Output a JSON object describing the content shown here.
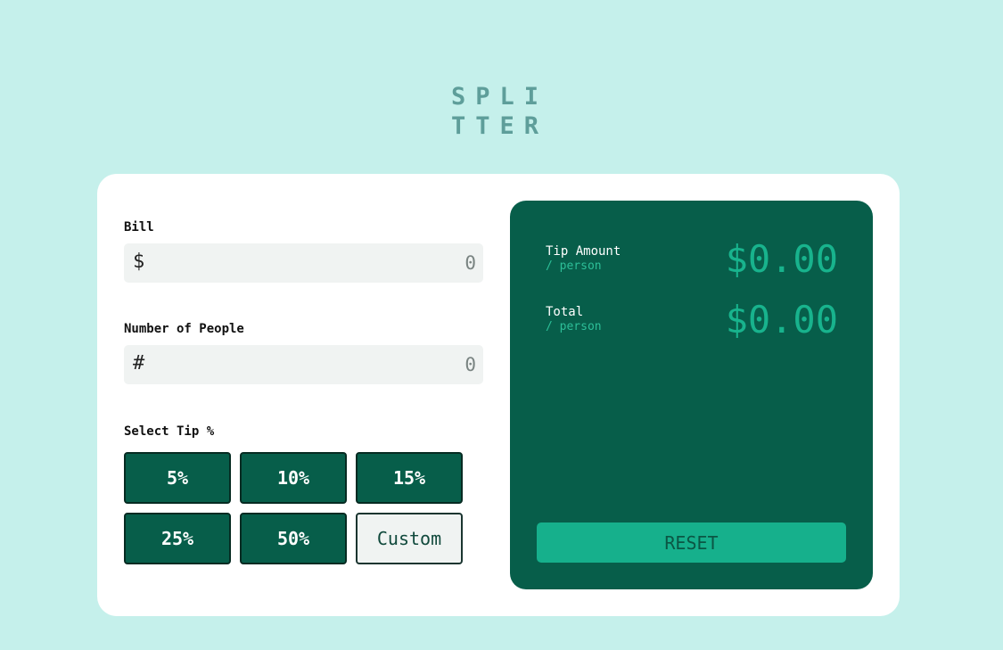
{
  "app": {
    "logo_line1": "SPLI",
    "logo_line2": "TTER"
  },
  "bill": {
    "label": "Bill",
    "prefix": "$",
    "placeholder": "0"
  },
  "people": {
    "label": "Number of People",
    "prefix": "#",
    "placeholder": "0"
  },
  "tip": {
    "label": "Select Tip %",
    "options": [
      "5%",
      "10%",
      "15%",
      "25%",
      "50%"
    ],
    "custom_label": "Custom"
  },
  "results": {
    "tip_title": "Tip Amount",
    "tip_sub": "/ person",
    "tip_value": "$0.00",
    "total_title": "Total",
    "total_sub": "/ person",
    "total_value": "$0.00",
    "reset_label": "RESET"
  },
  "colors": {
    "background": "#c5f0eb",
    "primary_dark": "#075e4a",
    "accent": "#16b08c",
    "card": "#ffffff"
  }
}
